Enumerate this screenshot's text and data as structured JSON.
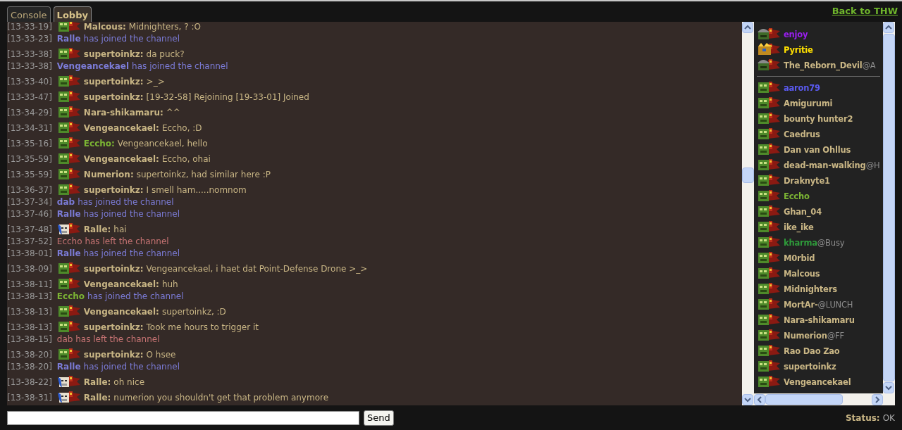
{
  "tabs": [
    {
      "label": "Console",
      "selected": false
    },
    {
      "label": "Lobby",
      "selected": true
    }
  ],
  "back_link": "Back to THW",
  "messages": [
    {
      "kind": "chat",
      "time": "[13-33-19]",
      "avatar": {
        "kind": "grunt"
      },
      "name": "Malcous:",
      "color": "#c9b685",
      "text": "Midnighters, ? :O"
    },
    {
      "kind": "join",
      "time": "[13-33-23]",
      "name": "Ralle",
      "color": "#7b7bd6",
      "text": "has joined the channel"
    },
    {
      "kind": "chat",
      "time": "[13-33-38]",
      "avatar": {
        "kind": "grunt"
      },
      "name": "supertoinkz:",
      "color": "#c9b685",
      "text": "da puck?"
    },
    {
      "kind": "join",
      "time": "[13-33-38]",
      "name": "Vengeancekael",
      "color": "#7b7bd6",
      "text": "has joined the channel"
    },
    {
      "kind": "chat",
      "time": "[13-33-40]",
      "avatar": {
        "kind": "grunt"
      },
      "name": "supertoinkz:",
      "color": "#c9b685",
      "text": ">_>"
    },
    {
      "kind": "chat",
      "time": "[13-33-47]",
      "avatar": {
        "kind": "grunt"
      },
      "name": "supertoinkz:",
      "color": "#c9b685",
      "text": "[19-32-58] Rejoining [19-33-01] Joined"
    },
    {
      "kind": "chat",
      "time": "[13-34-29]",
      "avatar": {
        "kind": "grunt"
      },
      "name": "Nara-shikamaru:",
      "color": "#c9b685",
      "text": "^^"
    },
    {
      "kind": "chat",
      "time": "[13-34-31]",
      "avatar": {
        "kind": "grunt"
      },
      "name": "Vengeancekael:",
      "color": "#c9b685",
      "text": "Eccho, :D"
    },
    {
      "kind": "chat",
      "time": "[13-35-16]",
      "avatar": {
        "kind": "grunt"
      },
      "name": "Eccho:",
      "color": "#7cb534",
      "text": "Vengeancekael, hello"
    },
    {
      "kind": "chat",
      "time": "[13-35-59]",
      "avatar": {
        "kind": "grunt"
      },
      "name": "Vengeancekael:",
      "color": "#c9b685",
      "text": "Eccho, ohai"
    },
    {
      "kind": "chat",
      "time": "[13-35-59]",
      "avatar": {
        "kind": "grunt"
      },
      "name": "Numerion:",
      "color": "#c9b685",
      "text": "supertoinkz, had similar here :P"
    },
    {
      "kind": "chat",
      "time": "[13-36-37]",
      "avatar": {
        "kind": "grunt"
      },
      "name": "supertoinkz:",
      "color": "#c9b685",
      "text": "I smell ham.....nomnom"
    },
    {
      "kind": "join",
      "time": "[13-37-34]",
      "name": "dab",
      "color": "#7b7bd6",
      "text": "has joined the channel"
    },
    {
      "kind": "join",
      "time": "[13-37-46]",
      "name": "Ralle",
      "color": "#7b7bd6",
      "text": "has joined the channel"
    },
    {
      "kind": "chat",
      "time": "[13-37-48]",
      "avatar": {
        "kind": "elder"
      },
      "name": "Ralle:",
      "color": "#c9b685",
      "text": "hai"
    },
    {
      "kind": "leave",
      "time": "[13-37-52]",
      "text": "Eccho has left the channel"
    },
    {
      "kind": "join",
      "time": "[13-38-01]",
      "name": "Ralle",
      "color": "#7b7bd6",
      "text": "has joined the channel"
    },
    {
      "kind": "chat",
      "time": "[13-38-09]",
      "avatar": {
        "kind": "grunt"
      },
      "name": "supertoinkz:",
      "color": "#c9b685",
      "text": "Vengeancekael, i haet dat Point-Defense Drone >_>"
    },
    {
      "kind": "chat",
      "time": "[13-38-11]",
      "avatar": {
        "kind": "grunt"
      },
      "name": "Vengeancekael:",
      "color": "#c9b685",
      "text": "huh"
    },
    {
      "kind": "join",
      "time": "[13-38-13]",
      "name": "Eccho",
      "color": "#7cb534",
      "text": "has joined the channel"
    },
    {
      "kind": "chat",
      "time": "[13-38-13]",
      "avatar": {
        "kind": "grunt"
      },
      "name": "Vengeancekael:",
      "color": "#c9b685",
      "text": "supertoinkz, :D"
    },
    {
      "kind": "chat",
      "time": "[13-38-13]",
      "avatar": {
        "kind": "grunt"
      },
      "name": "supertoinkz:",
      "color": "#c9b685",
      "text": "Took me hours to trigger it"
    },
    {
      "kind": "leave",
      "time": "[13-38-15]",
      "text": "dab has left the channel"
    },
    {
      "kind": "chat",
      "time": "[13-38-20]",
      "avatar": {
        "kind": "grunt"
      },
      "name": "supertoinkz:",
      "color": "#c9b685",
      "text": "O hsee"
    },
    {
      "kind": "join",
      "time": "[13-38-20]",
      "name": "Ralle",
      "color": "#7b7bd6",
      "text": "has joined the channel"
    },
    {
      "kind": "chat",
      "time": "[13-38-22]",
      "avatar": {
        "kind": "elder"
      },
      "name": "Ralle:",
      "color": "#c9b685",
      "text": "oh nice"
    },
    {
      "kind": "chat",
      "time": "[13-38-31]",
      "avatar": {
        "kind": "elder"
      },
      "name": "Ralle:",
      "color": "#c9b685",
      "text": "numerion you shouldn't get that problem anymore"
    }
  ],
  "user_groups": [
    {
      "users": [
        {
          "name": "enjoy",
          "color": "#9a1ef0",
          "avatar": {
            "kind": "helmet"
          }
        },
        {
          "name": "Pyritie",
          "color": "#ffe000",
          "avatar": {
            "kind": "crown"
          }
        },
        {
          "name": "The_Reborn_Devil",
          "color": "#c9b685",
          "status": "@A",
          "avatar": {
            "kind": "helmet"
          }
        }
      ]
    },
    {
      "users": [
        {
          "name": "aaron79",
          "color": "#5a5af0",
          "avatar": {
            "kind": "grunt"
          }
        },
        {
          "name": "Amigurumi",
          "color": "#c9b685",
          "avatar": {
            "kind": "grunt"
          }
        },
        {
          "name": "bounty hunter2",
          "color": "#c9b685",
          "avatar": {
            "kind": "grunt"
          }
        },
        {
          "name": "Caedrus",
          "color": "#c9b685",
          "avatar": {
            "kind": "grunt"
          }
        },
        {
          "name": "Dan van Ohllus",
          "color": "#c9b685",
          "avatar": {
            "kind": "grunt"
          }
        },
        {
          "name": "dead-man-walking",
          "color": "#c9b685",
          "status": "@H",
          "avatar": {
            "kind": "grunt"
          }
        },
        {
          "name": "Draknyte1",
          "color": "#c9b685",
          "avatar": {
            "kind": "grunt"
          }
        },
        {
          "name": "Eccho",
          "color": "#7cb534",
          "avatar": {
            "kind": "grunt"
          }
        },
        {
          "name": "Ghan_04",
          "color": "#c9b685",
          "avatar": {
            "kind": "grunt"
          }
        },
        {
          "name": "ike_ike",
          "color": "#c9b685",
          "avatar": {
            "kind": "grunt"
          }
        },
        {
          "name": "kharma",
          "color": "#2e9a3a",
          "status": "@Busy",
          "avatar": {
            "kind": "grunt"
          }
        },
        {
          "name": "M0rbid",
          "color": "#c9b685",
          "avatar": {
            "kind": "grunt"
          }
        },
        {
          "name": "Malcous",
          "color": "#c9b685",
          "avatar": {
            "kind": "grunt"
          }
        },
        {
          "name": "Midnighters",
          "color": "#c9b685",
          "avatar": {
            "kind": "grunt"
          }
        },
        {
          "name": "MortAr-",
          "color": "#c9b685",
          "status": "@LUNCH",
          "avatar": {
            "kind": "grunt"
          }
        },
        {
          "name": "Nara-shikamaru",
          "color": "#c9b685",
          "avatar": {
            "kind": "grunt"
          }
        },
        {
          "name": "Numerion",
          "color": "#c9b685",
          "status": "@FF",
          "avatar": {
            "kind": "grunt"
          }
        },
        {
          "name": "Rao Dao Zao",
          "color": "#c9b685",
          "avatar": {
            "kind": "grunt"
          }
        },
        {
          "name": "supertoinkz",
          "color": "#c9b685",
          "avatar": {
            "kind": "grunt"
          }
        },
        {
          "name": "Vengeancekael",
          "color": "#c9b685",
          "avatar": {
            "kind": "grunt"
          }
        }
      ]
    }
  ],
  "send_button": "Send",
  "status": {
    "label": "Status:",
    "value": "OK"
  }
}
